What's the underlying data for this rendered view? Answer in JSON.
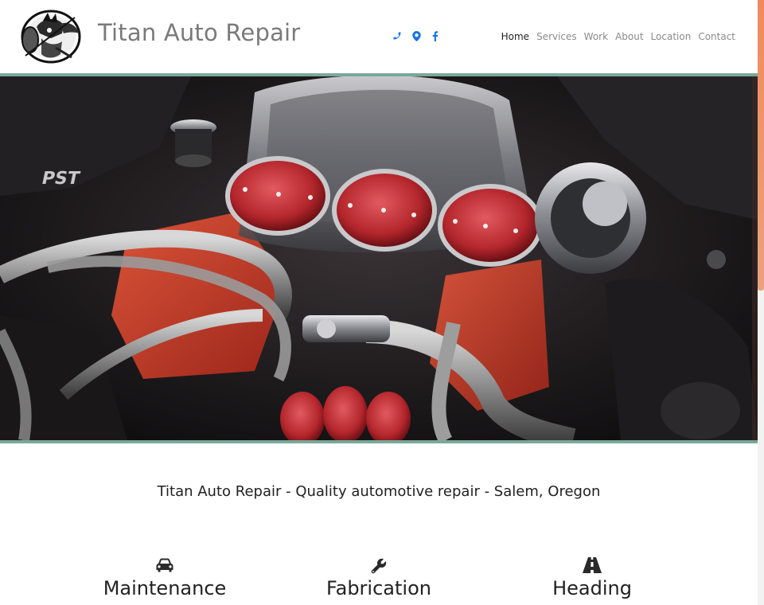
{
  "header": {
    "title": "Titan Auto Repair",
    "logo_icon": "spartan-warrior-logo",
    "social": [
      {
        "name": "phone-icon"
      },
      {
        "name": "map-marker-icon"
      },
      {
        "name": "facebook-icon"
      }
    ],
    "nav": [
      {
        "label": "Home",
        "active": true
      },
      {
        "label": "Services",
        "active": false
      },
      {
        "label": "Work",
        "active": false
      },
      {
        "label": "About",
        "active": false
      },
      {
        "label": "Location",
        "active": false
      },
      {
        "label": "Contact",
        "active": false
      }
    ]
  },
  "hero": {
    "image": "engine-photo",
    "visible_text": "PST"
  },
  "tagline": "Titan Auto Repair - Quality automotive repair - Salem, Oregon",
  "features": [
    {
      "icon": "car-icon",
      "title": "Maintenance"
    },
    {
      "icon": "wrench-icon",
      "title": "Fabrication"
    },
    {
      "icon": "road-icon",
      "title": "Heading"
    }
  ],
  "colors": {
    "accent_blue": "#1a73e8",
    "hero_border": "#7aa899",
    "scroll_thumb": "#f08a5d",
    "title_gray": "#7a7a7a"
  }
}
